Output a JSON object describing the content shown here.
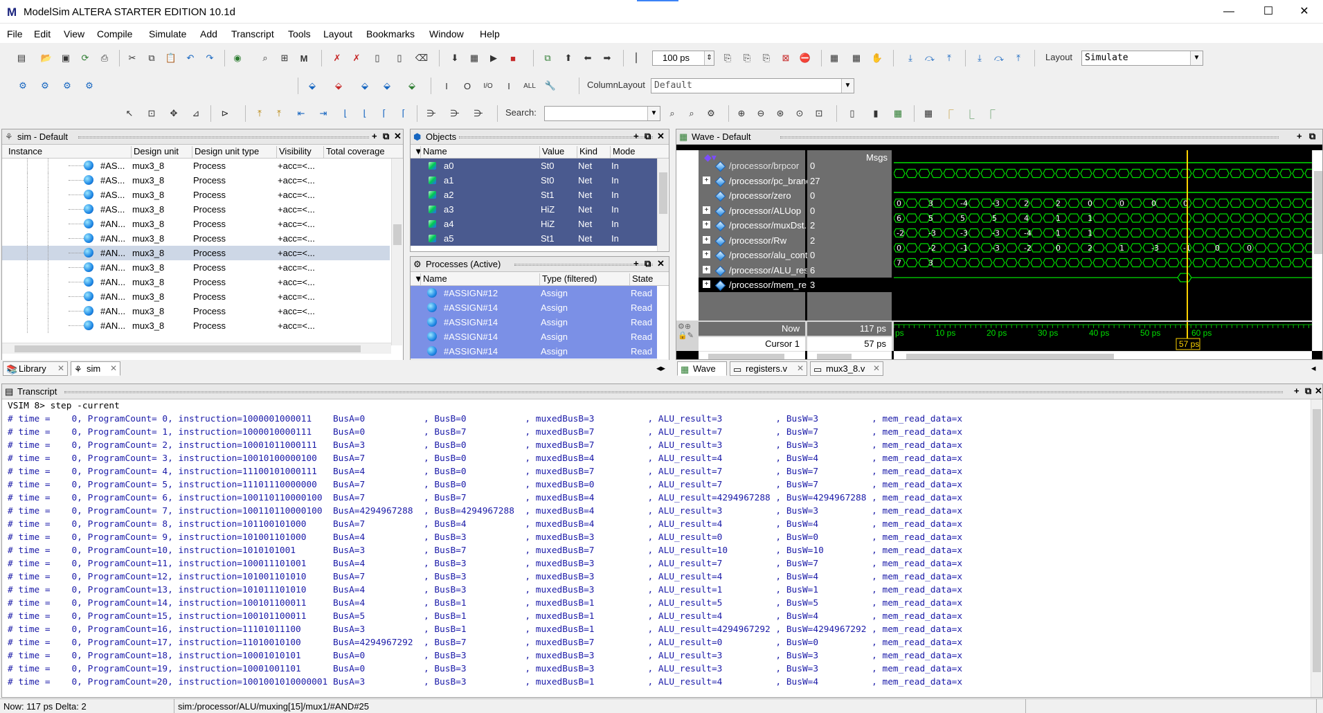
{
  "window": {
    "title": "ModelSim ALTERA STARTER EDITION 10.1d",
    "logo": "M"
  },
  "menu": [
    "File",
    "Edit",
    "View",
    "Compile",
    "Simulate",
    "Add",
    "Transcript",
    "Tools",
    "Layout",
    "Bookmarks",
    "Window",
    "Help"
  ],
  "toolbar": {
    "run_length": "100 ps",
    "layout_label": "Layout",
    "layout_value": "Simulate",
    "column_layout_label": "ColumnLayout",
    "column_layout_value": "Default",
    "search_label": "Search:",
    "search_value": ""
  },
  "sim_panel": {
    "title": "sim - Default",
    "columns": [
      "Instance",
      "Design unit",
      "Design unit type",
      "Visibility",
      "Total coverage"
    ],
    "rows": [
      {
        "instance": "#AS...",
        "unit": "mux3_8",
        "type": "Process",
        "vis": "+acc=<..."
      },
      {
        "instance": "#AS...",
        "unit": "mux3_8",
        "type": "Process",
        "vis": "+acc=<..."
      },
      {
        "instance": "#AS...",
        "unit": "mux3_8",
        "type": "Process",
        "vis": "+acc=<..."
      },
      {
        "instance": "#AS...",
        "unit": "mux3_8",
        "type": "Process",
        "vis": "+acc=<..."
      },
      {
        "instance": "#AN...",
        "unit": "mux3_8",
        "type": "Process",
        "vis": "+acc=<..."
      },
      {
        "instance": "#AN...",
        "unit": "mux3_8",
        "type": "Process",
        "vis": "+acc=<..."
      },
      {
        "instance": "#AN...",
        "unit": "mux3_8",
        "type": "Process",
        "vis": "+acc=<..."
      },
      {
        "instance": "#AN...",
        "unit": "mux3_8",
        "type": "Process",
        "vis": "+acc=<..."
      },
      {
        "instance": "#AN...",
        "unit": "mux3_8",
        "type": "Process",
        "vis": "+acc=<..."
      },
      {
        "instance": "#AN...",
        "unit": "mux3_8",
        "type": "Process",
        "vis": "+acc=<..."
      },
      {
        "instance": "#AN...",
        "unit": "mux3_8",
        "type": "Process",
        "vis": "+acc=<..."
      },
      {
        "instance": "#AN...",
        "unit": "mux3_8",
        "type": "Process",
        "vis": "+acc=<..."
      }
    ],
    "tabs": [
      "Library",
      "sim"
    ]
  },
  "objects_panel": {
    "title": "Objects",
    "columns": [
      "Name",
      "Value",
      "Kind",
      "Mode"
    ],
    "rows": [
      {
        "name": "a0",
        "value": "St0",
        "kind": "Net",
        "mode": "In"
      },
      {
        "name": "a1",
        "value": "St0",
        "kind": "Net",
        "mode": "In"
      },
      {
        "name": "a2",
        "value": "St1",
        "kind": "Net",
        "mode": "In"
      },
      {
        "name": "a3",
        "value": "HiZ",
        "kind": "Net",
        "mode": "In"
      },
      {
        "name": "a4",
        "value": "HiZ",
        "kind": "Net",
        "mode": "In"
      },
      {
        "name": "a5",
        "value": "St1",
        "kind": "Net",
        "mode": "In"
      }
    ]
  },
  "processes_panel": {
    "title": "Processes (Active)",
    "columns": [
      "Name",
      "Type (filtered)",
      "State"
    ],
    "rows": [
      {
        "name": "#ASSIGN#12",
        "type": "Assign",
        "state": "Read"
      },
      {
        "name": "#ASSIGN#14",
        "type": "Assign",
        "state": "Read"
      },
      {
        "name": "#ASSIGN#14",
        "type": "Assign",
        "state": "Read"
      },
      {
        "name": "#ASSIGN#14",
        "type": "Assign",
        "state": "Read"
      },
      {
        "name": "#ASSIGN#14",
        "type": "Assign",
        "state": "Read"
      }
    ]
  },
  "wave_panel": {
    "title": "Wave - Default",
    "msgs_label": "Msgs",
    "signals": [
      {
        "name": "/processor/brpcor",
        "value": "0"
      },
      {
        "name": "/processor/pc_branch",
        "value": "27"
      },
      {
        "name": "/processor/zero",
        "value": "0"
      },
      {
        "name": "/processor/ALUop",
        "value": "0"
      },
      {
        "name": "/processor/muxDst...",
        "value": "2"
      },
      {
        "name": "/processor/Rw",
        "value": "2"
      },
      {
        "name": "/processor/alu_cont...",
        "value": "0"
      },
      {
        "name": "/processor/ALU_result",
        "value": "6"
      },
      {
        "name": "/processor/mem_re...",
        "value": "3"
      }
    ],
    "now_label": "Now",
    "now_value": "117 ps",
    "cursor_label": "Cursor 1",
    "cursor_value": "57 ps",
    "cursor_flag": "57 ps",
    "time_ticks": [
      "ps",
      "10 ps",
      "20 ps",
      "30 ps",
      "40 ps",
      "50 ps",
      "60 ps"
    ],
    "bus_labels": {
      "ALUop": [
        "0",
        "3",
        "-4",
        "-3",
        "2",
        "2",
        "0",
        "0",
        "0",
        "0"
      ],
      "muxDst": [
        "6",
        "5",
        "5",
        "5",
        "4",
        "1",
        "1"
      ],
      "Rw": [
        "-2",
        "-3",
        "-3",
        "-3",
        "-4",
        "1",
        "1"
      ],
      "alu_cont": [
        "0",
        "-2",
        "-1",
        "-3",
        "-2",
        "0",
        "2",
        "1",
        "-3",
        "-1",
        "0",
        "0"
      ],
      "ALU_result": [
        "7",
        "3"
      ]
    },
    "tabs": [
      "Wave",
      "registers.v",
      "mux3_8.v"
    ]
  },
  "transcript": {
    "title": "Transcript",
    "prompt": "VSIM 8> step -current",
    "lines": [
      "# time =    0, ProgramCount= 0, instruction=1000001000011    BusA=0           , BusB=0           , muxedBusB=3          , ALU_result=3          , BusW=3          , mem_read_data=x",
      "# time =    0, ProgramCount= 1, instruction=1000010000111    BusA=0           , BusB=7           , muxedBusB=7          , ALU_result=7          , BusW=7          , mem_read_data=x",
      "# time =    0, ProgramCount= 2, instruction=10001011000111   BusA=3           , BusB=0           , muxedBusB=7          , ALU_result=3          , BusW=3          , mem_read_data=x",
      "# time =    0, ProgramCount= 3, instruction=10010100000100   BusA=7           , BusB=0           , muxedBusB=4          , ALU_result=4          , BusW=4          , mem_read_data=x",
      "# time =    0, ProgramCount= 4, instruction=11100101000111   BusA=4           , BusB=0           , muxedBusB=7          , ALU_result=7          , BusW=7          , mem_read_data=x",
      "# time =    0, ProgramCount= 5, instruction=11101110000000   BusA=7           , BusB=0           , muxedBusB=0          , ALU_result=7          , BusW=7          , mem_read_data=x",
      "# time =    0, ProgramCount= 6, instruction=100110110000100  BusA=7           , BusB=7           , muxedBusB=4          , ALU_result=4294967288 , BusW=4294967288 , mem_read_data=x",
      "# time =    0, ProgramCount= 7, instruction=100110110000100  BusA=4294967288  , BusB=4294967288  , muxedBusB=4          , ALU_result=3          , BusW=3          , mem_read_data=x",
      "# time =    0, ProgramCount= 8, instruction=101100101000     BusA=7           , BusB=4           , muxedBusB=4          , ALU_result=4          , BusW=4          , mem_read_data=x",
      "# time =    0, ProgramCount= 9, instruction=101001101000     BusA=4           , BusB=3           , muxedBusB=3          , ALU_result=0          , BusW=0          , mem_read_data=x",
      "# time =    0, ProgramCount=10, instruction=1010101001       BusA=3           , BusB=7           , muxedBusB=7          , ALU_result=10         , BusW=10         , mem_read_data=x",
      "# time =    0, ProgramCount=11, instruction=100011101001     BusA=4           , BusB=3           , muxedBusB=3          , ALU_result=7          , BusW=7          , mem_read_data=x",
      "# time =    0, ProgramCount=12, instruction=101001101010     BusA=7           , BusB=3           , muxedBusB=3          , ALU_result=4          , BusW=4          , mem_read_data=x",
      "# time =    0, ProgramCount=13, instruction=101011101010     BusA=4           , BusB=3           , muxedBusB=3          , ALU_result=1          , BusW=1          , mem_read_data=x",
      "# time =    0, ProgramCount=14, instruction=100101100011     BusA=4           , BusB=1           , muxedBusB=1          , ALU_result=5          , BusW=5          , mem_read_data=x",
      "# time =    0, ProgramCount=15, instruction=100101100011     BusA=5           , BusB=1           , muxedBusB=1          , ALU_result=4          , BusW=4          , mem_read_data=x",
      "# time =    0, ProgramCount=16, instruction=11101011100      BusA=3           , BusB=1           , muxedBusB=1          , ALU_result=4294967292 , BusW=4294967292 , mem_read_data=x",
      "# time =    0, ProgramCount=17, instruction=11010010100      BusA=4294967292  , BusB=7           , muxedBusB=7          , ALU_result=0          , BusW=0          , mem_read_data=x",
      "# time =    0, ProgramCount=18, instruction=10001010101      BusA=0           , BusB=3           , muxedBusB=3          , ALU_result=3          , BusW=3          , mem_read_data=x",
      "# time =    0, ProgramCount=19, instruction=10001001101      BusA=0           , BusB=3           , muxedBusB=3          , ALU_result=3          , BusW=3          , mem_read_data=x",
      "# time =    0, ProgramCount=20, instruction=1001001010000001 BusA=3           , BusB=3           , muxedBusB=1          , ALU_result=4          , BusW=4          , mem_read_data=x"
    ]
  },
  "status": {
    "now": "Now: 117 ps  Delta: 2",
    "path": "sim:/processor/ALU/muxing[15]/mux1/#AND#25"
  }
}
